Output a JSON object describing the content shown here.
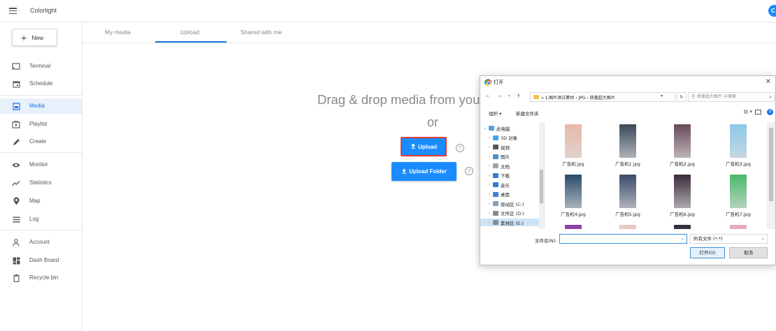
{
  "header": {
    "app_title": "Colorlight",
    "avatar_letter": "C"
  },
  "sidebar": {
    "new_label": "New",
    "items": [
      {
        "label": "Terminal",
        "icon": "cast-icon"
      },
      {
        "label": "Schedule",
        "icon": "calendar-icon"
      },
      {
        "label": "Media",
        "icon": "media-icon",
        "active": true
      },
      {
        "label": "Playlist",
        "icon": "playlist-icon"
      },
      {
        "label": "Create",
        "icon": "pencil-icon"
      },
      {
        "label": "Monitor",
        "icon": "eye-icon"
      },
      {
        "label": "Statistics",
        "icon": "trend-icon"
      },
      {
        "label": "Map",
        "icon": "location-pin-icon"
      },
      {
        "label": "Log",
        "icon": "list-icon"
      },
      {
        "label": "Account",
        "icon": "person-icon"
      },
      {
        "label": "Dash Board",
        "icon": "dashboard-icon"
      },
      {
        "label": "Recycle bin",
        "icon": "trash-icon"
      }
    ]
  },
  "tabs": [
    "My media",
    "Upload",
    "Shared with me"
  ],
  "active_tab": "Upload",
  "main": {
    "drag_text": "Drag & drop media from you",
    "or_text": "or",
    "upload_label": "Upload",
    "upload_folder_label": "Upload Folder",
    "help_glyph": "?"
  },
  "dialog": {
    "title": "打开",
    "close_glyph": "×",
    "nav_back": "←",
    "nav_forward": "→",
    "nav_up": "↑",
    "path": "« 1.图片测试素材 › JPG › 质量超大图片",
    "search_placeholder": "在 质量超大图片 中搜索",
    "organize_label": "组织 ▾",
    "new_folder_label": "新建文件夹",
    "tree": [
      {
        "label": "此电脑",
        "expanded": true,
        "color": "#5aa0e0"
      },
      {
        "label": "3D 对象",
        "color": "#3aa6e8"
      },
      {
        "label": "视频",
        "color": "#555555"
      },
      {
        "label": "图片",
        "color": "#4a90c8"
      },
      {
        "label": "文档",
        "color": "#9aa7b5"
      },
      {
        "label": "下载",
        "color": "#2f7fd0"
      },
      {
        "label": "音乐",
        "color": "#2f7fd0"
      },
      {
        "label": "桌面",
        "color": "#3b82d6"
      },
      {
        "label": "驱动区 (C:)",
        "color": "#8aa0b5"
      },
      {
        "label": "文件区 (D:)",
        "color": "#8a8a8a"
      },
      {
        "label": "素材区 (E:)",
        "color": "#8a8a8a",
        "selected": true
      }
    ],
    "files": [
      {
        "name": "广告机.jpg",
        "color": "#e8b8a8"
      },
      {
        "name": "广告机1.jpg",
        "color": "#3a4a5a"
      },
      {
        "name": "广告机2.jpg",
        "color": "#6a4a5a"
      },
      {
        "name": "广告机3.jpg",
        "color": "#8ac8e8"
      },
      {
        "name": "广告机4.jpg",
        "color": "#2a4a6a"
      },
      {
        "name": "广告机5.jpg",
        "color": "#3a4a6a"
      },
      {
        "name": "广告机6.jpg",
        "color": "#3a2a3a"
      },
      {
        "name": "广告机7.jpg",
        "color": "#4ab86a"
      },
      {
        "name": "",
        "color": "#8a3aa8"
      },
      {
        "name": "",
        "color": "#e8c8c0"
      },
      {
        "name": "",
        "color": "#2a2a3a"
      },
      {
        "name": "",
        "color": "#e8a8b8"
      }
    ],
    "filename_label": "文件名(N):",
    "filename_value": "",
    "filetype_value": "所有文件 (*.*)",
    "open_label": "打开(O)",
    "cancel_label": "取消"
  },
  "colors": {
    "accent": "#1a8cff",
    "highlight_border": "#e53935",
    "active_nav_bg": "#e8f0fb"
  }
}
